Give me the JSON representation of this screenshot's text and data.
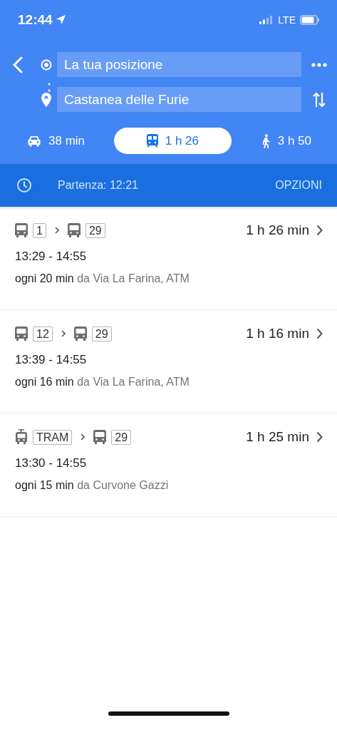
{
  "status_bar": {
    "time": "12:44",
    "network": "LTE"
  },
  "directions": {
    "origin": {
      "value": "La tua posizione"
    },
    "destination": {
      "value": "Castanea delle Furie"
    }
  },
  "modes": [
    {
      "kind": "car",
      "label": "38 min",
      "selected": false
    },
    {
      "kind": "transit",
      "label": "1 h 26",
      "selected": true
    },
    {
      "kind": "walk",
      "label": "3 h 50",
      "selected": false
    }
  ],
  "options_bar": {
    "departure": "Partenza: 12:21",
    "options": "OPZIONI"
  },
  "routes": [
    {
      "legs": [
        {
          "kind": "bus",
          "line": "1"
        },
        {
          "kind": "bus",
          "line": "29"
        }
      ],
      "duration": "1 h 26 min",
      "times": "13:29 - 14:55",
      "frequency": "ogni 20 min",
      "origin": "da Via La Farina, ATM"
    },
    {
      "legs": [
        {
          "kind": "bus",
          "line": "12"
        },
        {
          "kind": "bus",
          "line": "29"
        }
      ],
      "duration": "1 h 16 min",
      "times": "13:39 - 14:55",
      "frequency": "ogni 16 min",
      "origin": "da Via La Farina, ATM"
    },
    {
      "legs": [
        {
          "kind": "tram",
          "line": "TRAM"
        },
        {
          "kind": "bus",
          "line": "29"
        }
      ],
      "duration": "1 h 25 min",
      "times": "13:30 - 14:55",
      "frequency": "ogni 15 min",
      "origin": "da Curvone Gazzi"
    }
  ]
}
